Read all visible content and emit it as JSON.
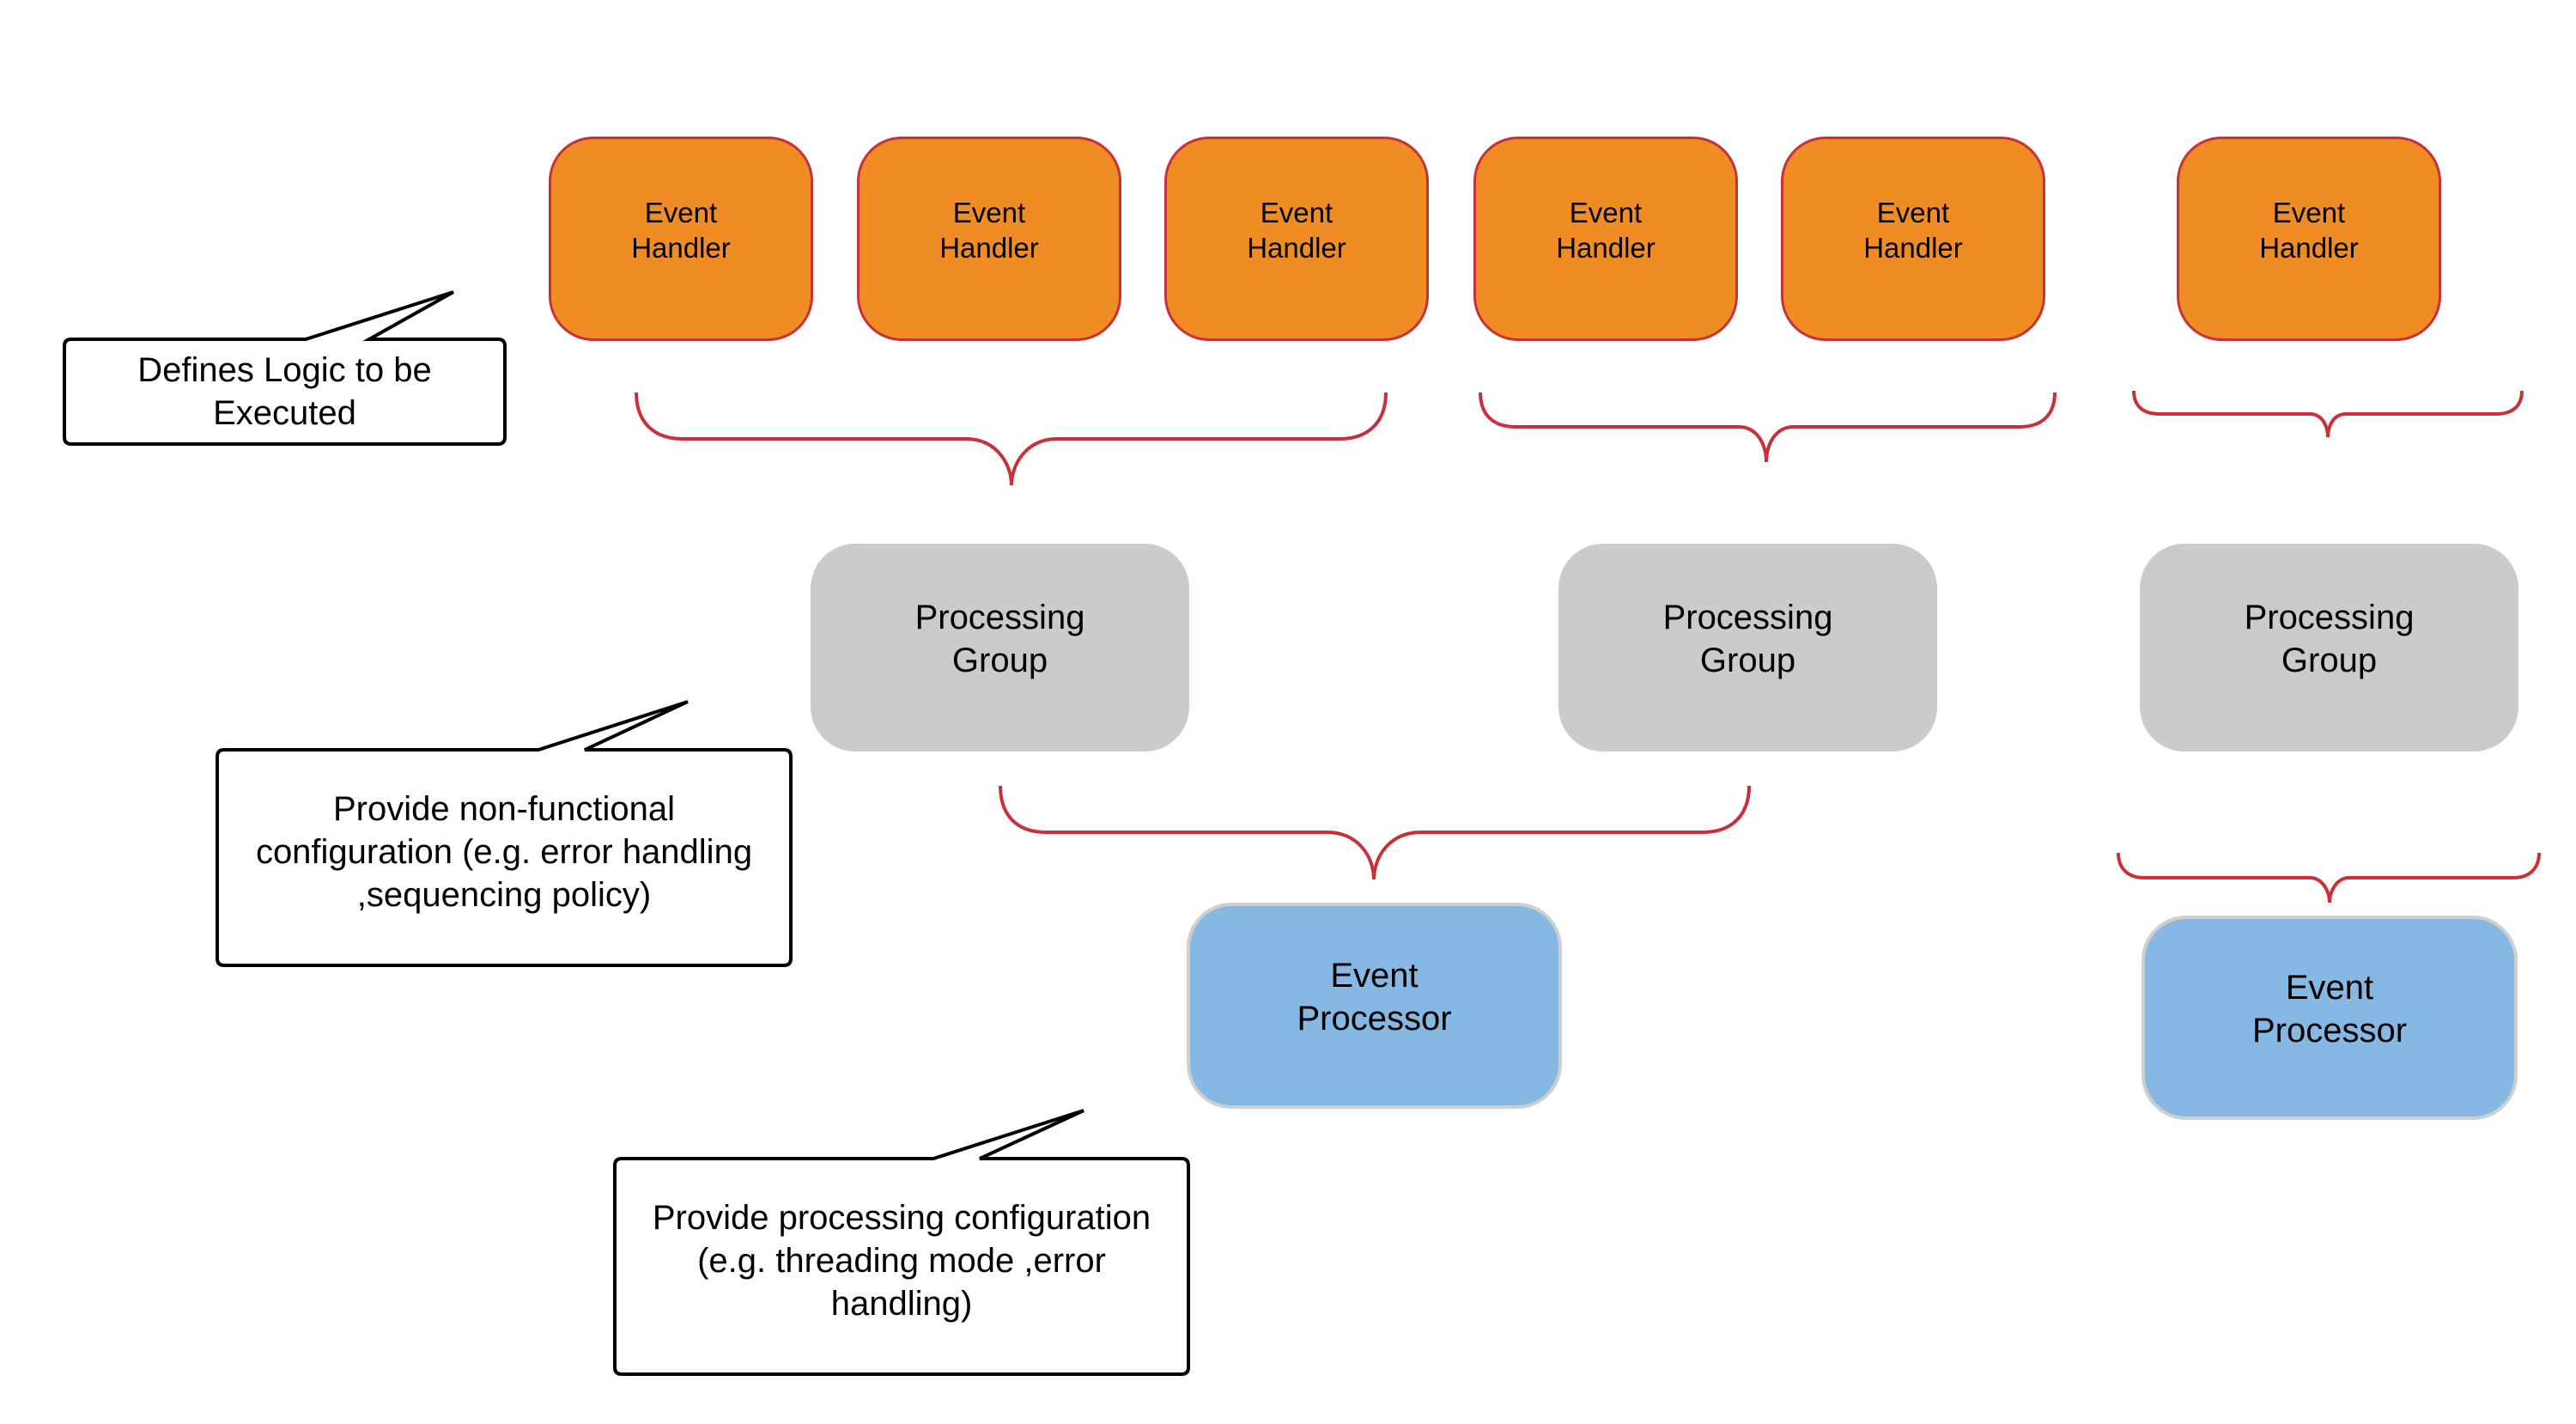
{
  "diagram": {
    "event_handlers": [
      {
        "label": "Event\nHandler"
      },
      {
        "label": "Event\nHandler"
      },
      {
        "label": "Event\nHandler"
      },
      {
        "label": "Event\nHandler"
      },
      {
        "label": "Event\nHandler"
      },
      {
        "label": "Event\nHandler"
      }
    ],
    "processing_groups": [
      {
        "label": "Processing\nGroup"
      },
      {
        "label": "Processing\nGroup"
      },
      {
        "label": "Processing\nGroup"
      }
    ],
    "event_processors": [
      {
        "label": "Event\nProcessor"
      },
      {
        "label": "Event\nProcessor"
      }
    ],
    "callouts": {
      "handlers": "Defines Logic to be\nExecuted",
      "groups": "Provide non-functional\nconfiguration (e.g. error handling\n,sequencing policy)",
      "processors": "Provide processing configuration\n(e.g. threading mode ,error\nhandling)"
    },
    "colors": {
      "handler_fill": "#f08c24",
      "handler_border": "#c8303a",
      "group_fill": "#cbcbcb",
      "processor_fill": "#85b8e3",
      "brace": "#c8303a"
    },
    "relations": [
      {
        "from": "handlers 1-3",
        "to": "processing group 1"
      },
      {
        "from": "handlers 4-5",
        "to": "processing group 2"
      },
      {
        "from": "handler 6",
        "to": "processing group 3"
      },
      {
        "from": "processing groups 1-2",
        "to": "event processor 1"
      },
      {
        "from": "processing group 3",
        "to": "event processor 2"
      }
    ]
  }
}
